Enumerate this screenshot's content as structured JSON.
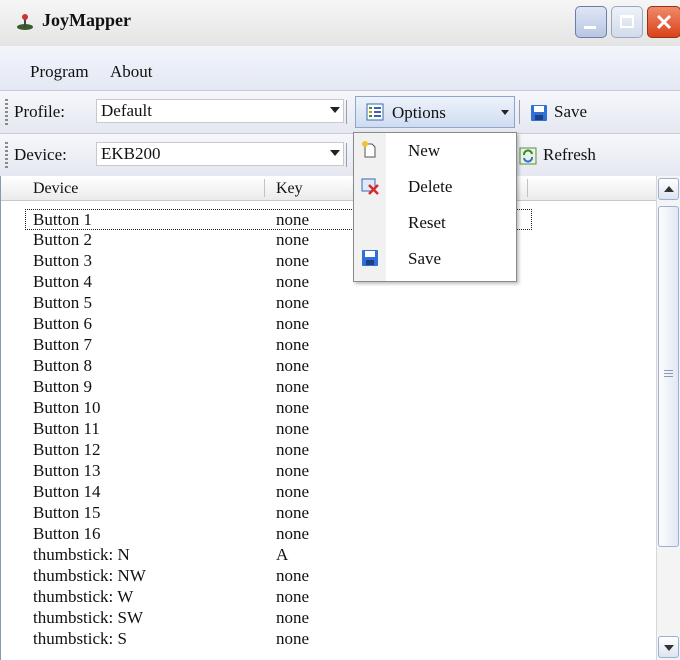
{
  "window": {
    "title": "JoyMapper"
  },
  "menu": {
    "items": [
      "Program",
      "About"
    ]
  },
  "profile_bar": {
    "label": "Profile:",
    "value": "Default",
    "options_label": "Options",
    "save_label": "Save"
  },
  "device_bar": {
    "label": "Device:",
    "value": "EKB200",
    "refresh_label": "Refresh"
  },
  "options_menu": {
    "items": [
      {
        "label": "New",
        "icon": "new-icon"
      },
      {
        "label": "Delete",
        "icon": "delete-icon"
      },
      {
        "label": "Reset",
        "icon": ""
      },
      {
        "label": "Save",
        "icon": "floppy-icon"
      }
    ]
  },
  "list": {
    "columns": [
      "Device",
      "Key"
    ],
    "rows": [
      {
        "device": "Button 1",
        "key": "none"
      },
      {
        "device": "Button 2",
        "key": "none"
      },
      {
        "device": "Button 3",
        "key": "none"
      },
      {
        "device": "Button 4",
        "key": "none"
      },
      {
        "device": "Button 5",
        "key": "none"
      },
      {
        "device": "Button 6",
        "key": "none"
      },
      {
        "device": "Button 7",
        "key": "none"
      },
      {
        "device": "Button 8",
        "key": "none"
      },
      {
        "device": "Button 9",
        "key": "none"
      },
      {
        "device": "Button 10",
        "key": "none"
      },
      {
        "device": "Button 11",
        "key": "none"
      },
      {
        "device": "Button 12",
        "key": "none"
      },
      {
        "device": "Button 13",
        "key": "none"
      },
      {
        "device": "Button 14",
        "key": "none"
      },
      {
        "device": "Button 15",
        "key": "none"
      },
      {
        "device": "Button 16",
        "key": "none"
      },
      {
        "device": "thumbstick: N",
        "key": "A"
      },
      {
        "device": "thumbstick: NW",
        "key": "none"
      },
      {
        "device": "thumbstick: W",
        "key": "none"
      },
      {
        "device": "thumbstick: SW",
        "key": "none"
      },
      {
        "device": "thumbstick: S",
        "key": "none"
      }
    ]
  },
  "colors": {
    "accent": "#2f6fd6",
    "close_red": "#d9421c"
  }
}
